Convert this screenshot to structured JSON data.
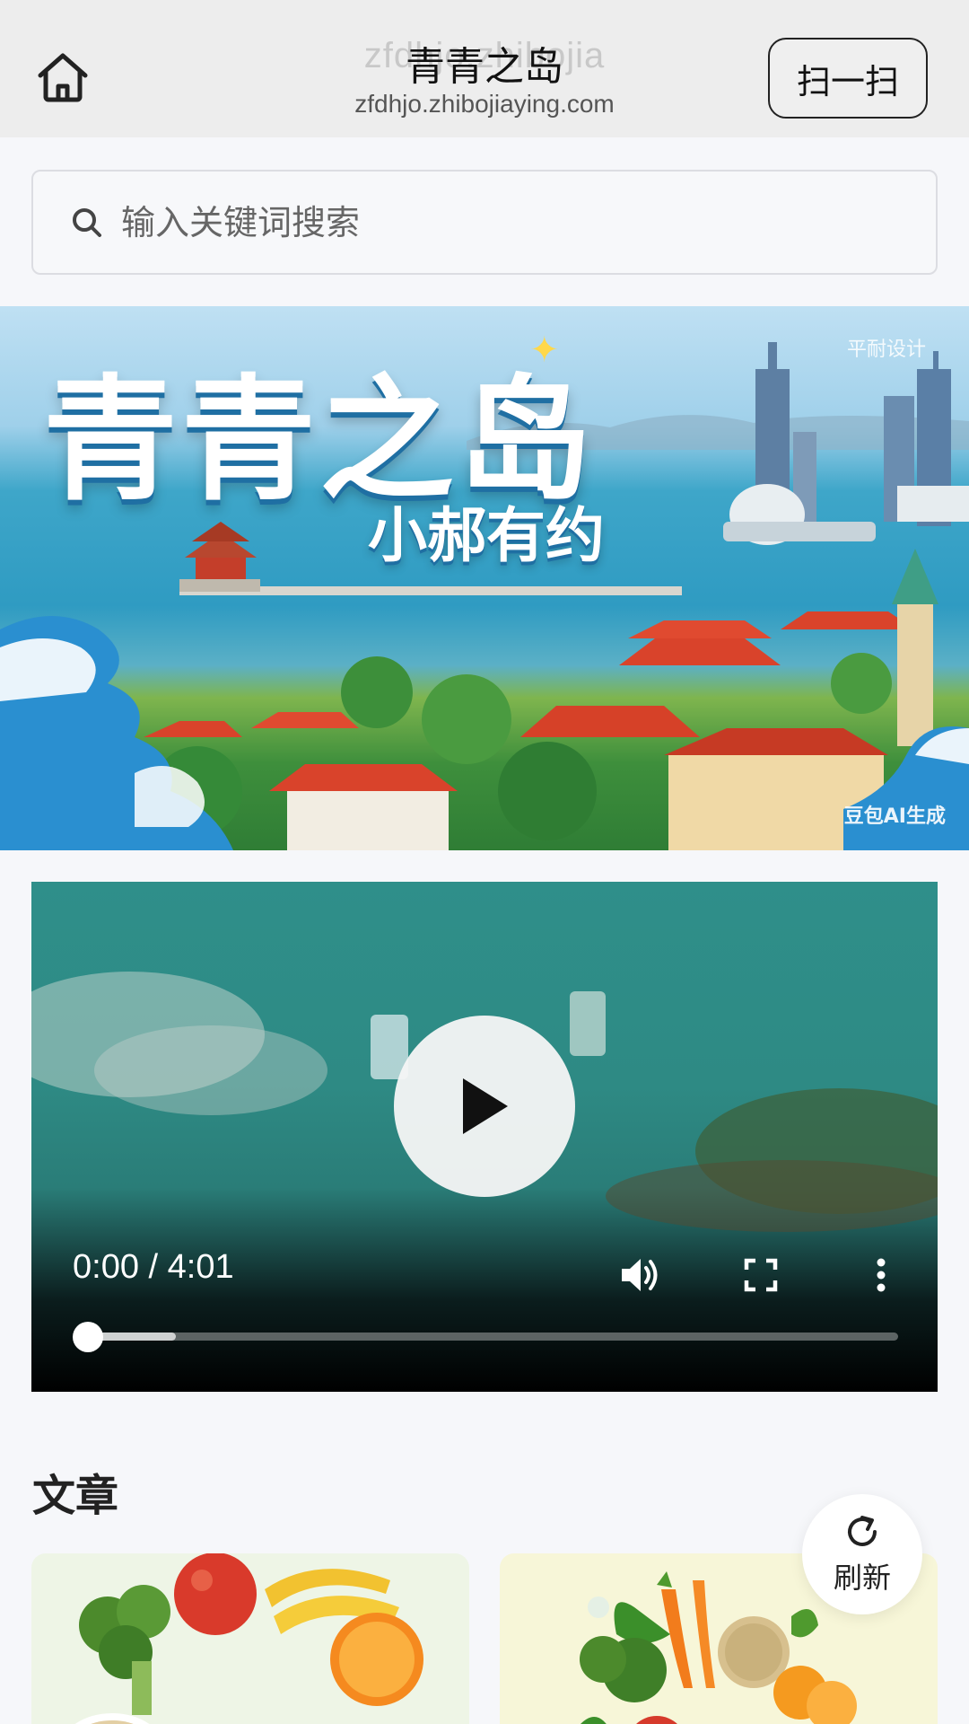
{
  "header": {
    "title": "青青之岛",
    "ghost_title": "zfdhjo.zhibojia",
    "url": "zfdhjo.zhibojiaying.com",
    "scan_label": "扫一扫",
    "home_icon": "home-icon"
  },
  "search": {
    "placeholder": "输入关键词搜索",
    "value": "",
    "icon": "search-icon"
  },
  "banner": {
    "title": "青青之岛",
    "subtitle": "小郝有约",
    "watermark_top": "平耐设计",
    "watermark_bottom": "豆包AI生成"
  },
  "video": {
    "time": "0:00 / 4:01",
    "progress": 0.0,
    "buffered": 0.11,
    "icons": [
      "play-icon",
      "volume-icon",
      "fullscreen-icon",
      "more-vert-icon"
    ]
  },
  "articles": {
    "section_title": "文章"
  },
  "refresh": {
    "label": "刷新",
    "icon": "refresh-icon"
  },
  "colors": {
    "header_bg": "#ededed",
    "page_bg": "#f6f7fa",
    "video_teal": "#2f8f8a"
  }
}
